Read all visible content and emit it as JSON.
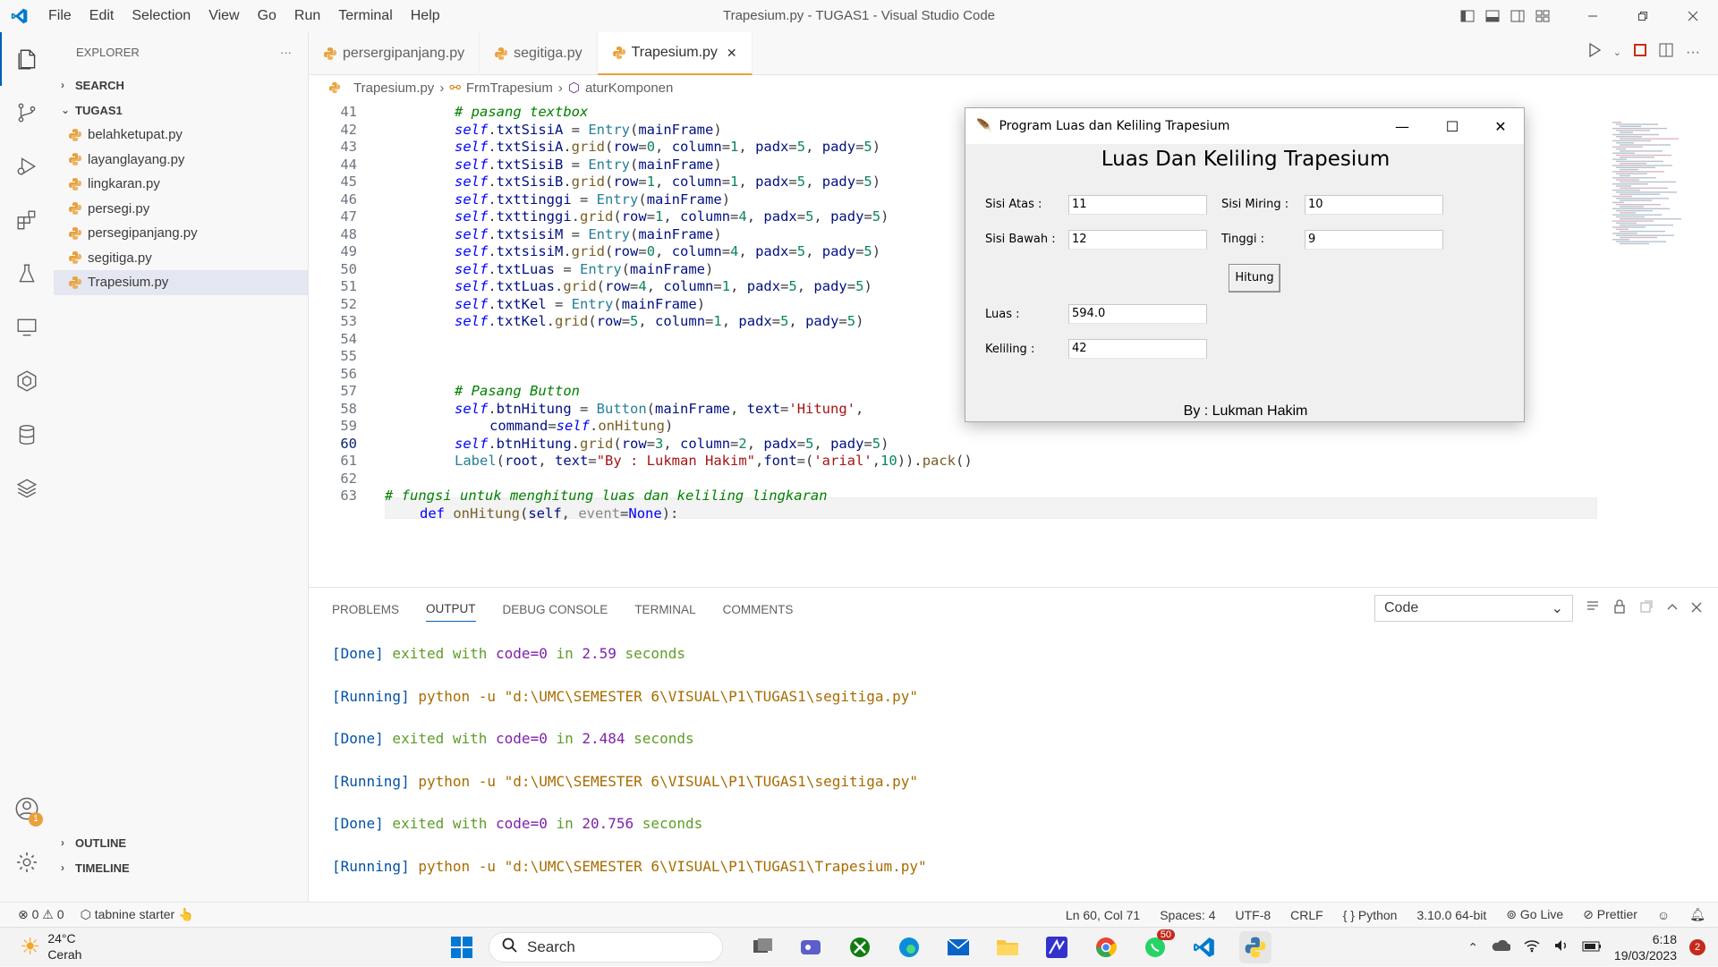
{
  "window": {
    "title": "Trapesium.py - TUGAS1 - Visual Studio Code",
    "menu": [
      "File",
      "Edit",
      "Selection",
      "View",
      "Go",
      "Run",
      "Terminal",
      "Help"
    ]
  },
  "sidebar": {
    "header": "EXPLORER",
    "more": "···",
    "search_section": "SEARCH",
    "folder": "TUGAS1",
    "files": [
      "belahketupat.py",
      "layanglayang.py",
      "lingkaran.py",
      "persegi.py",
      "persegipanjang.py",
      "segitiga.py",
      "Trapesium.py"
    ],
    "selected_file": "Trapesium.py",
    "outline": "OUTLINE",
    "timeline": "TIMELINE",
    "accounts_badge": "1"
  },
  "tabs": [
    {
      "label": "persergipanjang.py"
    },
    {
      "label": "segitiga.py"
    },
    {
      "label": "Trapesium.py"
    }
  ],
  "breadcrumb": {
    "file": "Trapesium.py",
    "class": "FrmTrapesium",
    "method": "aturKomponen"
  },
  "code": {
    "line_numbers": [
      "41",
      "42",
      "43",
      "44",
      "45",
      "46",
      "47",
      "48",
      "49",
      "50",
      "51",
      "52",
      "53",
      "54",
      "55",
      "56",
      "57",
      "58",
      "59",
      "60",
      "61",
      "62",
      "63"
    ],
    "current_line": "60"
  },
  "panel": {
    "tabs": [
      "PROBLEMS",
      "OUTPUT",
      "DEBUG CONSOLE",
      "TERMINAL",
      "COMMENTS"
    ],
    "active_tab": "OUTPUT",
    "channel": "Code",
    "output": [
      {
        "tag": "[Done]",
        "text": " exited with ",
        "code": "code=0",
        "in": " in ",
        "num": "2.59",
        "unit": " seconds"
      },
      {
        "tag": "[Running]",
        "text": " python -u \"d:\\UMC\\SEMESTER 6\\VISUAL\\P1\\TUGAS1\\segitiga.py\""
      },
      {
        "tag": "[Done]",
        "text": " exited with ",
        "code": "code=0",
        "in": " in ",
        "num": "2.484",
        "unit": " seconds"
      },
      {
        "tag": "[Running]",
        "text": " python -u \"d:\\UMC\\SEMESTER 6\\VISUAL\\P1\\TUGAS1\\segitiga.py\""
      },
      {
        "tag": "[Done]",
        "text": " exited with ",
        "code": "code=0",
        "in": " in ",
        "num": "20.756",
        "unit": " seconds"
      },
      {
        "tag": "[Running]",
        "text": " python -u \"d:\\UMC\\SEMESTER 6\\VISUAL\\P1\\TUGAS1\\Trapesium.py\""
      }
    ]
  },
  "statusbar": {
    "errors": "0",
    "warnings": "0",
    "tabnine": "tabnine starter",
    "position": "Ln 60, Col 71",
    "spaces": "Spaces: 4",
    "encoding": "UTF-8",
    "eol": "CRLF",
    "language": "Python",
    "interpreter": "3.10.0 64-bit",
    "golive": "Go Live",
    "prettier": "Prettier"
  },
  "app": {
    "title": "Program Luas dan Keliling Trapesium",
    "heading": "Luas Dan Keliling Trapesium",
    "sisi_atas_label": "Sisi Atas :",
    "sisi_atas_value": "11",
    "sisi_miring_label": "Sisi Miring :",
    "sisi_miring_value": "10",
    "sisi_bawah_label": "Sisi Bawah :",
    "sisi_bawah_value": "12",
    "tinggi_label": "Tinggi :",
    "tinggi_value": "9",
    "button": "Hitung",
    "luas_label": "Luas :",
    "luas_value": "594.0",
    "keliling_label": "Keliling :",
    "keliling_value": "42",
    "author": "By : Lukman Hakim"
  },
  "taskbar": {
    "temp": "24°C",
    "weather": "Cerah",
    "search": "Search",
    "whatsapp_badge": "50",
    "time": "6:18",
    "date": "19/03/2023",
    "notif": "2"
  }
}
